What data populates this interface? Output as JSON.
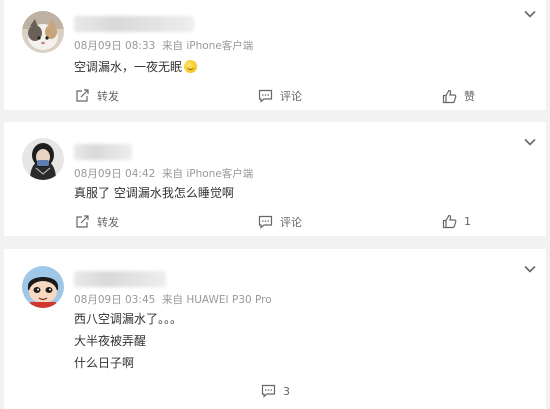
{
  "comments": [
    {
      "timestamp": "08月09日 08:33",
      "source": "来自 iPhone客户端",
      "lines": [
        "空调漏水，一夜无眠"
      ],
      "actions": {
        "repost": "转发",
        "comment": "评论",
        "like": "赞"
      }
    },
    {
      "timestamp": "08月09日 04:42",
      "source": "来自 iPhone客户端",
      "lines": [
        "真服了 空调漏水我怎么睡觉啊"
      ],
      "actions": {
        "repost": "转发",
        "comment": "评论",
        "like": "1"
      }
    },
    {
      "timestamp": "08月09日 03:45",
      "source": "来自 HUAWEI P30 Pro",
      "lines": [
        "西八空调漏水了。。。",
        "大半夜被弄醒",
        "什么日子啊"
      ],
      "actions": {
        "comment": "3"
      }
    }
  ],
  "icons": {
    "avatar_0": "cat-photo-avatar",
    "avatar_1": "person-avatar",
    "avatar_2": "cartoon-avatar",
    "emoji": "tears-of-joy-emoji",
    "menu": "chevron-down-icon",
    "repost": "repost-icon",
    "comment": "comment-icon",
    "like": "thumbs-up-icon"
  },
  "colors": {
    "background": "#f2f2f2",
    "card": "#ffffff",
    "text": "#333333",
    "meta": "#999999",
    "action": "#666666"
  }
}
